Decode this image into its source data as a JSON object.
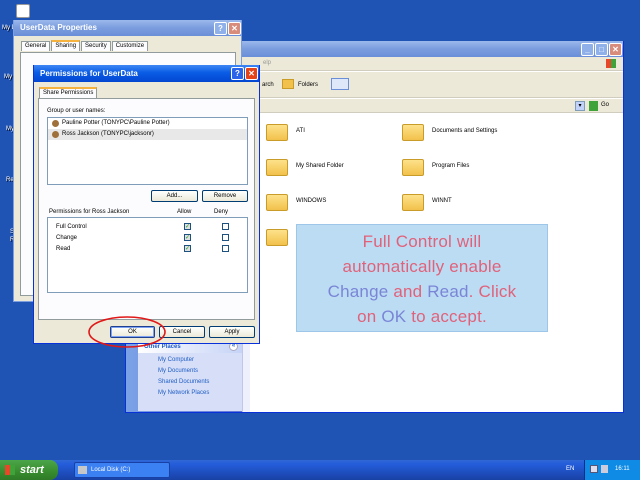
{
  "desktop": {
    "icon_labels": [
      "My Do",
      "My",
      "My",
      "Re",
      "S R"
    ]
  },
  "userdata_props": {
    "title": "UserData Properties",
    "tabs": [
      "General",
      "Sharing",
      "Security",
      "Customize"
    ],
    "close": "✕",
    "help": "?"
  },
  "explorer": {
    "menu_fragment": "elp",
    "toolbar": {
      "search": "arch",
      "folders": "Folders"
    },
    "go": "Go",
    "folders": [
      "ATI",
      "Documents and Settings",
      "My Shared Folder",
      "Program Files",
      "WINDOWS",
      "WINNT",
      "E"
    ],
    "other_places": {
      "title": "Other Places",
      "items": [
        "My Computer",
        "My Documents",
        "Shared Documents",
        "My Network Places"
      ]
    }
  },
  "permissions": {
    "title": "Permissions for UserData",
    "tab": "Share Permissions",
    "group_label": "Group or user names:",
    "users": [
      "Pauline Potter (TONYPC\\Pauline Potter)",
      "Ross Jackson (TONYPC\\jacksonr)"
    ],
    "add": "Add...",
    "remove": "Remove",
    "perm_label": "Permissions for Ross Jackson",
    "allow": "Allow",
    "deny": "Deny",
    "perms": [
      "Full Control",
      "Change",
      "Read"
    ],
    "ok": "OK",
    "cancel": "Cancel",
    "apply": "Apply"
  },
  "callout": {
    "l1": "Full Control will",
    "l2": "automatically enable",
    "w_change": "Change",
    "w_and": " and ",
    "w_read": "Read",
    "w_click": ". Click",
    "w_on": "on ",
    "w_ok": "OK",
    "w_accept": " to accept."
  },
  "taskbar": {
    "start": "start",
    "task": "Local Disk (C:)",
    "lang": "EN",
    "time": "16:11"
  }
}
